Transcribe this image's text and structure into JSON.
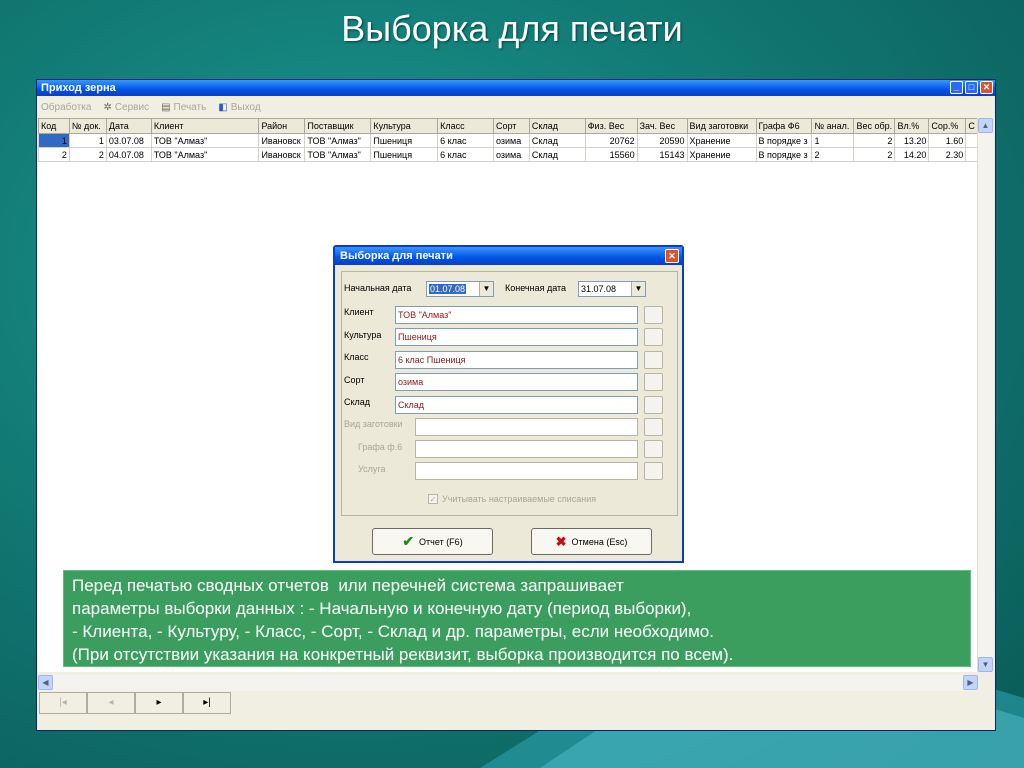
{
  "slide": {
    "title": "Выборка для печати",
    "caption_lines": [
      "Перед печатью сводных отчетов  или перечней система запрашивает",
      "параметры выборки данных : - Начальную и конечную дату (период выборки),",
      "- Клиента, - Культуру, - Класс, - Сорт, - Склад и др. параметры, если необходимо.",
      "(При отсутствии указания на конкретный реквизит, выборка производится по всем)."
    ]
  },
  "app": {
    "title": "Приход зерна",
    "menu": {
      "processing": "Обработка",
      "service": "Сервис",
      "print": "Печать",
      "exit": "Выход"
    },
    "columns": [
      "Код",
      "№ док.",
      "Дата",
      "Клиент",
      "Район",
      "Поставщик",
      "Культура",
      "Класс",
      "Сорт",
      "Склад",
      "Физ. Вес",
      "Зач. Вес",
      "Вид заготовки",
      "Графа Ф6",
      "№ анал.",
      "Вес обр.",
      "Вл.%",
      "Сор.%",
      "С"
    ],
    "rows": [
      [
        "1",
        "1",
        "03.07.08",
        "ТОВ \"Алмаз\"",
        "Ивановск",
        "ТОВ \"Алмаз\"",
        "Пшениця",
        "6 клас",
        "озима",
        "Склад",
        "20762",
        "20590",
        "Хранение",
        "В порядке з",
        "1",
        "2",
        "13.20",
        "1.60",
        ""
      ],
      [
        "2",
        "2",
        "04.07.08",
        "ТОВ \"Алмаз\"",
        "Ивановск",
        "ТОВ \"Алмаз\"",
        "Пшениця",
        "6 клас",
        "озима",
        "Склад",
        "15560",
        "15143",
        "Хранение",
        "В порядке з",
        "2",
        "2",
        "14.20",
        "2.30",
        ""
      ]
    ],
    "nav": {
      "first": "|◂",
      "prev": "◂",
      "next": "▸",
      "last": "▸|"
    }
  },
  "dialog": {
    "title": "Выборка для печати",
    "start_date_label": "Начальная дата",
    "start_date": "01.07.08",
    "end_date_label": "Конечная дата",
    "end_date": "31.07.08",
    "client_label": "Клиент",
    "client": "ТОВ \"Алмаз\"",
    "crop_label": "Культура",
    "crop": "Пшениця",
    "class_label": "Класс",
    "class_value": "6 клас Пшениця",
    "sort_label": "Сорт",
    "sort_value": "озима",
    "warehouse_label": "Склад",
    "warehouse": "Склад",
    "procurement_label": "Вид заготовки",
    "f6_label": "Графа ф.6",
    "service_label": "Услуга",
    "checkbox_label": "Учитывать настраиваемые списания",
    "report_button": "Отчет (F6)",
    "cancel_button": "Отмена (Esc)"
  }
}
